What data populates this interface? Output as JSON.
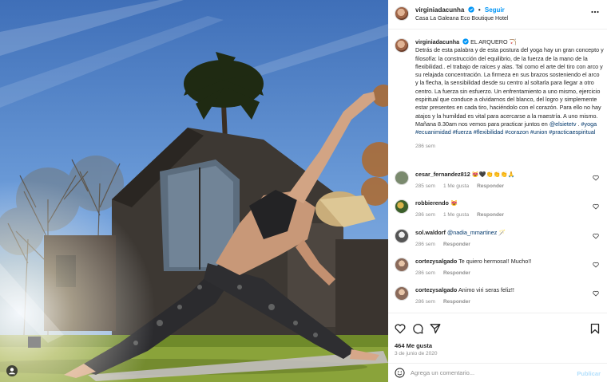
{
  "post": {
    "username": "virginiadacunha",
    "follow_label": "Seguir",
    "dot": "•",
    "location": "Casa La Galeana Eco Boutique Hotel"
  },
  "caption": {
    "username": "virginiadacunha",
    "title": "EL ARQUERO 🏹",
    "text": "Detrás de esta palabra y de esta postura del yoga hay un gran concepto y filosofía: la construcción del equilibrio, de la fuerza de la mano de la flexibilidad.. el trabajo de raíces y alas. Tal como el arte del tiro con arco y su relajada concentración. La firmeza en sus brazos sosteniendo el arco y la flecha, la sensibilidad desde su centro al soltarla para llegar a otro centro. La fuerza sin esfuerzo. Un enfrentamiento a uno mismo, ejercicio espiritual que conduce a olvidarnos del blanco, del logro y simplemente estar presentes en cada tiro, haciéndolo con el corazón. Para ello no hay atajos y la humildad es vital para acercarse a la maestría. A uno mismo. Mañana 8.30am nos vemos para practicar juntos en",
    "mention": "@elsietetv",
    "after_mention": ".",
    "hashtags": "#yoga #ecuanimidad #fuerza #flexibilidad #corazon #union #practicaespiritual",
    "time": "286 sem"
  },
  "comments": [
    {
      "username": "cesar_fernandez812",
      "text": "😻🖤👏👏👏🙏",
      "time": "285 sem",
      "likes": "1 Me gusta",
      "reply": "Responder",
      "avatar_color": "#7a8a6e"
    },
    {
      "username": "robbierendo",
      "text": "😻",
      "time": "286 sem",
      "likes": "1 Me gusta",
      "reply": "Responder",
      "avatar_color": "#3b5f2a"
    },
    {
      "username": "sol.waldorf",
      "mention": "@nadia_mmartinez",
      "text": "🪄",
      "time": "286 sem",
      "likes": "",
      "reply": "Responder",
      "avatar_color": "#555555"
    },
    {
      "username": "cortezysalgado",
      "text": "Te quiero hermosa!! Mucho!!",
      "time": "286 sem",
      "likes": "",
      "reply": "Responder",
      "avatar_color": "#8a6a5a"
    },
    {
      "username": "cortezysalgado",
      "text": "Animo viri seras feliz!!",
      "time": "286 sem",
      "likes": "",
      "reply": "Responder",
      "avatar_color": "#8a6a5a"
    }
  ],
  "footer": {
    "likes": "464 Me gusta",
    "date": "3 de junio de 2020",
    "comment_placeholder": "Agrega un comentario...",
    "post_label": "Publicar"
  },
  "icons": {
    "like": "heart-icon",
    "comment": "comment-icon",
    "share": "share-icon",
    "save": "bookmark-icon",
    "emoji": "emoji-icon",
    "more": "more-icon",
    "verified": "verified-icon"
  },
  "colors": {
    "link": "#00376b",
    "follow": "#0095f6",
    "publish_disabled": "#b2dffc",
    "meta": "#8e8e8e"
  }
}
